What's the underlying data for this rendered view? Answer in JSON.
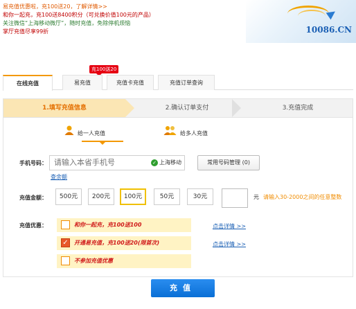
{
  "promo": {
    "line1": "易充值优惠啦，充100送20，了解详情>>",
    "line2": "和你一起充，充100送8400积分（可兑换价值100元的产品）",
    "line3": "关注微信“上海移动微厅”，随时充值，免除停机烦恼",
    "line4": "掌厅充值尽享99折"
  },
  "banner": {
    "logo": "10086.CN"
  },
  "tabs": [
    {
      "label": "在线充值"
    },
    {
      "label": "易充值"
    },
    {
      "label": "充值卡充值"
    },
    {
      "label": "充值订单查询"
    }
  ],
  "tab_badge": "充100送20",
  "steps": [
    {
      "label": "1.填写充值信息"
    },
    {
      "label": "2.确认订单支付"
    },
    {
      "label": "3.充值完成"
    }
  ],
  "modes": [
    {
      "label": "给一人充值"
    },
    {
      "label": "给多人充值"
    }
  ],
  "form": {
    "phone_label": "手机号码：",
    "phone_placeholder": "请输入本省手机号",
    "carrier": "上海移动",
    "manage_button": "常用号码管理 (0)",
    "query_link": "查余额",
    "amount_label": "充值金额：",
    "amounts": [
      "500元",
      "200元",
      "100元",
      "50元",
      "30元"
    ],
    "selected_amount": "100元",
    "unit": "元",
    "amount_hint": "请输入30-2000之间的任意整数",
    "offer_label": "充值优惠：",
    "offers": [
      {
        "text": "和你一起充，充100送100",
        "checked": false
      },
      {
        "text": "开通易充值，充100送20(限首次)",
        "checked": true
      },
      {
        "text": "不参加充值优惠",
        "checked": false
      }
    ],
    "detail_link": "点击详情 >>"
  },
  "submit": "充值",
  "colors": {
    "accent": "#f39800",
    "link": "#1a5fb4",
    "button": "#0a6fd6",
    "badge": "#e60012"
  }
}
